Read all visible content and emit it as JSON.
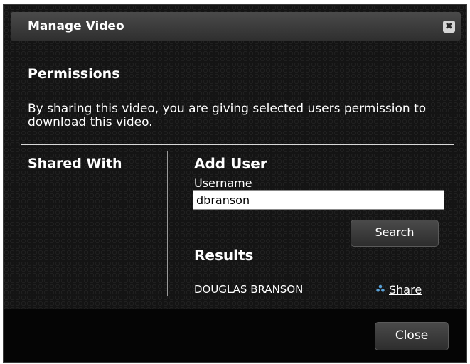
{
  "dialog": {
    "title": "Manage Video",
    "close_icon_glyph": "✖"
  },
  "permissions": {
    "heading": "Permissions",
    "description": "By sharing this video, you are giving selected users permission to download this video."
  },
  "shared_with": {
    "label": "Shared With"
  },
  "add_user": {
    "heading": "Add User",
    "username_label": "Username",
    "username_value": "dbranson",
    "search_label": "Search"
  },
  "results": {
    "heading": "Results",
    "items": [
      {
        "name": "DOUGLAS BRANSON",
        "action_label": "Share"
      }
    ]
  },
  "footer": {
    "close_label": "Close"
  },
  "colors": {
    "background": "#141414",
    "accent_icon": "#5aa2d8"
  }
}
